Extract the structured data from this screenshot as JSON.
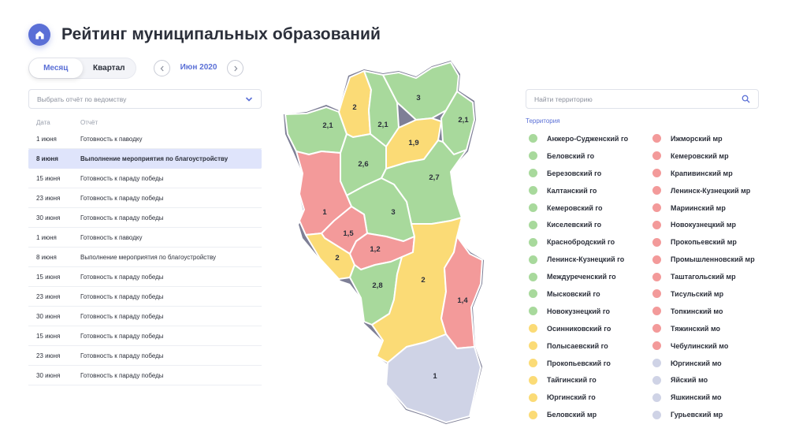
{
  "header": {
    "title": "Рейтинг муниципальных образований",
    "home_icon": "home-icon"
  },
  "period": {
    "options": [
      "Месяц",
      "Квартал"
    ],
    "active": "Месяц",
    "current": "Июн 2020"
  },
  "report_select": {
    "placeholder": "Выбрать отчёт по ведомству"
  },
  "table": {
    "columns": [
      "Дата",
      "Отчёт"
    ],
    "rows": [
      {
        "date": "1 июня",
        "report": "Готовность к паводку"
      },
      {
        "date": "8 июня",
        "report": "Выполнение мероприятия по благоустройству",
        "selected": true
      },
      {
        "date": "15 июня",
        "report": "Готовность к параду победы"
      },
      {
        "date": "23 июня",
        "report": "Готовность к параду победы"
      },
      {
        "date": "30 июня",
        "report": "Готовность к параду победы"
      },
      {
        "date": "1 июня",
        "report": "Готовность к паводку"
      },
      {
        "date": "8 июня",
        "report": "Выполнение мероприятия по благоустройству"
      },
      {
        "date": "15 июня",
        "report": "Готовность к параду победы"
      },
      {
        "date": "23 июня",
        "report": "Готовность к параду победы"
      },
      {
        "date": "30 июня",
        "report": "Готовность к параду победы"
      },
      {
        "date": "15 июня",
        "report": "Готовность к параду победы"
      },
      {
        "date": "23 июня",
        "report": "Готовность к параду победы"
      },
      {
        "date": "30 июня",
        "report": "Готовность к параду победы"
      }
    ]
  },
  "colors": {
    "accent": "#5a6fd6",
    "green": "#a8d99c",
    "yellow": "#fbdb76",
    "red": "#f39a9a",
    "grey": "#cfd3e6",
    "map_border": "#7e7f96",
    "map_inner_border": "#ffffff"
  },
  "map": {
    "regions": [
      {
        "label": "2,1",
        "color": "green"
      },
      {
        "label": "2",
        "color": "yellow"
      },
      {
        "label": "2,1",
        "color": "green"
      },
      {
        "label": "3",
        "color": "green"
      },
      {
        "label": "2,1",
        "color": "green"
      },
      {
        "label": "1,9",
        "color": "yellow"
      },
      {
        "label": "2,6",
        "color": "green"
      },
      {
        "label": "2,7",
        "color": "green"
      },
      {
        "label": "3",
        "color": "green"
      },
      {
        "label": "1",
        "color": "red"
      },
      {
        "label": "1,5",
        "color": "red"
      },
      {
        "label": "2",
        "color": "yellow"
      },
      {
        "label": "1,2",
        "color": "red"
      },
      {
        "label": "2,8",
        "color": "green"
      },
      {
        "label": "2",
        "color": "yellow"
      },
      {
        "label": "1,4",
        "color": "red"
      },
      {
        "label": "1",
        "color": "grey"
      }
    ]
  },
  "territory": {
    "search_placeholder": "Найти территорию",
    "legend_title": "Территория",
    "col1": [
      {
        "name": "Анжеро-Судженский го",
        "color": "green"
      },
      {
        "name": "Беловский го",
        "color": "green"
      },
      {
        "name": "Березовский го",
        "color": "green"
      },
      {
        "name": "Калтанский го",
        "color": "green"
      },
      {
        "name": "Кемеровский го",
        "color": "green"
      },
      {
        "name": "Киселевский го",
        "color": "green"
      },
      {
        "name": "Краснобродский го",
        "color": "green"
      },
      {
        "name": "Ленинск-Кузнецкий го",
        "color": "green"
      },
      {
        "name": "Междуреченский го",
        "color": "green"
      },
      {
        "name": "Мысковский го",
        "color": "green"
      },
      {
        "name": "Новокузнецкий го",
        "color": "green"
      },
      {
        "name": "Осинниковский го",
        "color": "yellow"
      },
      {
        "name": "Полысаевский го",
        "color": "yellow"
      },
      {
        "name": "Прокопьевский го",
        "color": "yellow"
      },
      {
        "name": "Тайгинский го",
        "color": "yellow"
      },
      {
        "name": "Юргинский го",
        "color": "yellow"
      },
      {
        "name": "Беловский мр",
        "color": "yellow"
      }
    ],
    "col2": [
      {
        "name": "Ижморский мр",
        "color": "red"
      },
      {
        "name": "Кемеровский мр",
        "color": "red"
      },
      {
        "name": "Крапивинский мр",
        "color": "red"
      },
      {
        "name": "Ленинск-Кузнецкий мр",
        "color": "red"
      },
      {
        "name": "Мариинский мр",
        "color": "red"
      },
      {
        "name": "Новокузнецкий мр",
        "color": "red"
      },
      {
        "name": "Прокопьевский мр",
        "color": "red"
      },
      {
        "name": "Промышленновский мр",
        "color": "red"
      },
      {
        "name": "Таштагольский мр",
        "color": "red"
      },
      {
        "name": "Тисульский мр",
        "color": "red"
      },
      {
        "name": "Топкинский мо",
        "color": "red"
      },
      {
        "name": "Тяжинский мо",
        "color": "red"
      },
      {
        "name": "Чебулинский мо",
        "color": "red"
      },
      {
        "name": "Юргинский мо",
        "color": "grey"
      },
      {
        "name": "Яйский мо",
        "color": "grey"
      },
      {
        "name": "Яшкинский мо",
        "color": "grey"
      },
      {
        "name": "Гурьевский мр",
        "color": "grey"
      }
    ]
  }
}
